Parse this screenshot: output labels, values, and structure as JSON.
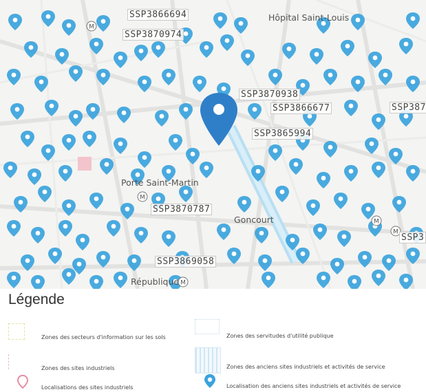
{
  "map": {
    "places": [
      "Hôpital Saint-Louis",
      "Porte Saint-Martin",
      "Goncourt",
      "République"
    ],
    "site_labels": [
      "SSP3866694",
      "SSP3870974",
      "SSP3870938",
      "SSP3866677",
      "SSP3865994",
      "SSP3870787",
      "SSP3869058",
      "SSP387",
      "SSP3"
    ],
    "pin_color": "#3aa3dd",
    "selected_pin_color": "#2f7fc8",
    "metro_icon": "metro-m-icon"
  },
  "legend": {
    "title": "Légende",
    "items": [
      "Zones des secteurs d'information sur les sols",
      "Zones des servitudes d'utilité publique",
      "Zones des sites industriels",
      "Zones des anciens sites industriels et activités de service",
      "Localisations des sites industriels",
      "Localisation des anciens sites industriels et activités de service"
    ]
  }
}
